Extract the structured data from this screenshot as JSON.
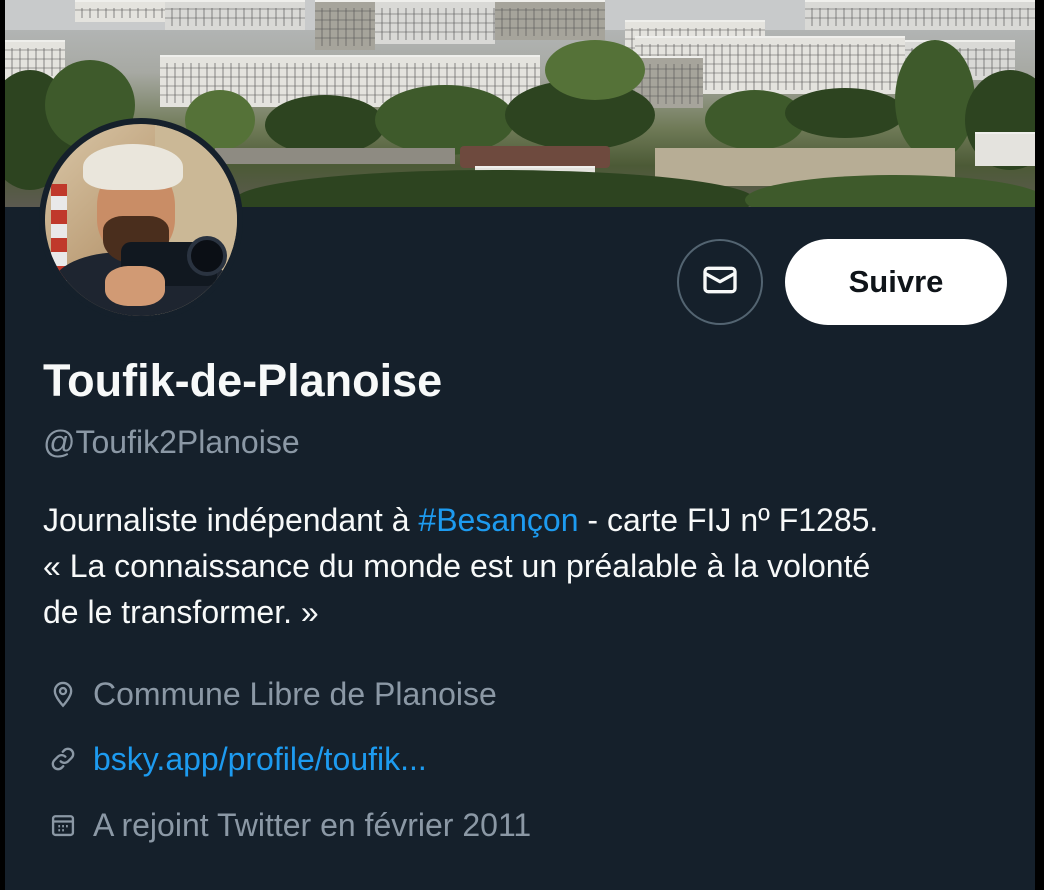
{
  "profile": {
    "display_name": "Toufik-de-Planoise",
    "handle": "@Toufik2Planoise",
    "bio": {
      "part1": "Journaliste indépendant à ",
      "hashtag": "#Besançon",
      "part2": " - carte FIJ nº F1285.",
      "line2": "« La connaissance du monde est un préalable à la volonté",
      "line3": "de le transformer. »"
    },
    "location": "Commune Libre de Planoise",
    "website": "bsky.app/profile/toufik...",
    "joined": "A rejoint Twitter en février 2011"
  },
  "actions": {
    "message_icon": "envelope-icon",
    "follow_label": "Suivre"
  },
  "icons": {
    "location": "location-pin-icon",
    "link": "link-icon",
    "calendar": "calendar-icon"
  },
  "colors": {
    "background": "#15202b",
    "primary_text": "#f7f9f9",
    "secondary_text": "#8b98a5",
    "accent": "#1d9bf0",
    "follow_button_bg": "#ffffff"
  }
}
